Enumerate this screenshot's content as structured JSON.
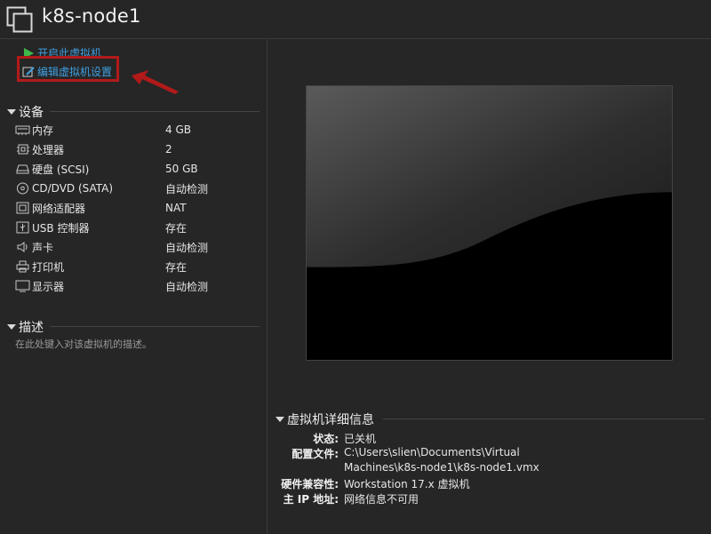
{
  "window": {
    "title": "k8s-node1"
  },
  "actions": {
    "start": "开启此虚拟机",
    "edit": "编辑虚拟机设置"
  },
  "devices": {
    "header": "设备",
    "items": [
      {
        "icon": "memory-icon",
        "name": "内存",
        "value": "4 GB"
      },
      {
        "icon": "cpu-icon",
        "name": "处理器",
        "value": "2"
      },
      {
        "icon": "harddisk-icon",
        "name": "硬盘 (SCSI)",
        "value": "50 GB"
      },
      {
        "icon": "cd-dvd-icon",
        "name": "CD/DVD (SATA)",
        "value": "自动检测"
      },
      {
        "icon": "network-adapter-icon",
        "name": "网络适配器",
        "value": "NAT"
      },
      {
        "icon": "usb-controller-icon",
        "name": "USB 控制器",
        "value": "存在"
      },
      {
        "icon": "sound-card-icon",
        "name": "声卡",
        "value": "自动检测"
      },
      {
        "icon": "printer-icon",
        "name": "打印机",
        "value": "存在"
      },
      {
        "icon": "display-icon",
        "name": "显示器",
        "value": "自动检测"
      }
    ]
  },
  "description": {
    "header": "描述",
    "placeholder": "在此处键入对该虚拟机的描述。"
  },
  "details": {
    "header": "虚拟机详细信息",
    "rows": [
      {
        "label": "状态:",
        "value": "已关机"
      },
      {
        "label": "配置文件:",
        "value": "C:\\Users\\slien\\Documents\\Virtual"
      },
      {
        "label": "",
        "value": "Machines\\k8s-node1\\k8s-node1.vmx"
      },
      {
        "label": "硬件兼容性:",
        "value": "Workstation 17.x 虚拟机"
      },
      {
        "label": "主 IP 地址:",
        "value": "网络信息不可用"
      }
    ]
  },
  "colors": {
    "background": "#262626",
    "link": "#3f9fe0",
    "highlight": "#b21a1a"
  }
}
